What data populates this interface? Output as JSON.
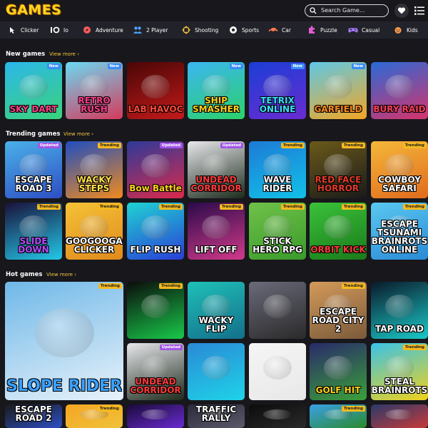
{
  "header": {
    "logo": "GAMES",
    "search_placeholder": "Search Game..."
  },
  "nav": [
    {
      "label": "Clicker",
      "icon": "cursor-click-icon",
      "color": "#ffffff"
    },
    {
      "label": "Io",
      "icon": "io-icon",
      "color": "#ffffff"
    },
    {
      "label": "Adventure",
      "icon": "compass-icon",
      "color": "#ff5a5a"
    },
    {
      "label": "2 Player",
      "icon": "two-player-icon",
      "color": "#4da3ff"
    },
    {
      "label": "Shooting",
      "icon": "crosshair-icon",
      "color": "#f5c63f"
    },
    {
      "label": "Sports",
      "icon": "soccer-ball-icon",
      "color": "#ffffff"
    },
    {
      "label": "Car",
      "icon": "car-icon",
      "color": "#ff7a4d"
    },
    {
      "label": "Puzzle",
      "icon": "puzzle-icon",
      "color": "#e55ad1"
    },
    {
      "label": "Casual",
      "icon": "gamepad-icon",
      "color": "#a57bff"
    },
    {
      "label": "Kids",
      "icon": "kids-icon",
      "color": "#ff9d4d"
    }
  ],
  "sections": {
    "new": {
      "title": "New games",
      "view_more": "View more ›"
    },
    "trending": {
      "title": "Trending games",
      "view_more": "View more ›"
    },
    "hot": {
      "title": "Hot games",
      "view_more": "View more ›"
    }
  },
  "badges": {
    "new": "New",
    "updated": "Updated",
    "trending": "Trending"
  },
  "new_games": [
    {
      "title": "SKY DART",
      "badge": "new",
      "bg": "#2bb7ea",
      "bg2": "#3ad37a",
      "fg": "#ff3f87"
    },
    {
      "title": "RETRO RUSH",
      "badge": "new",
      "bg": "#6cd9f2",
      "bg2": "#d43a5c",
      "fg": "#ff3d8b"
    },
    {
      "title": "LAB HAVOC",
      "badge": "",
      "bg": "#4a0606",
      "bg2": "#c31a1a",
      "fg": "#ff4a3a"
    },
    {
      "title": "SHIP SMASHER",
      "badge": "new",
      "bg": "#3bb6f2",
      "bg2": "#2bd16b",
      "fg": "#ffd11a"
    },
    {
      "title": "TETRIX ONLINE",
      "badge": "new",
      "bg": "#1b3ed6",
      "bg2": "#6a2bd1",
      "fg": "#3ae0ff"
    },
    {
      "title": "GARFIELD",
      "badge": "new",
      "bg": "#5ec8e6",
      "bg2": "#f3a623",
      "fg": "#ff8a1a"
    },
    {
      "title": "BURY RAID",
      "badge": "",
      "bg": "#2a6ad6",
      "bg2": "#d6336c",
      "fg": "#ff3d5a"
    }
  ],
  "trending_games": [
    {
      "title": "ESCAPE ROAD 3",
      "badge": "updated",
      "bg": "#4bb0e8",
      "bg2": "#2d4fc4",
      "fg": "#ffffff"
    },
    {
      "title": "WACKY STEPS",
      "badge": "trending",
      "bg": "#1f4ec0",
      "bg2": "#f08a1f",
      "fg": "#ffe14a"
    },
    {
      "title": "Bow Battle",
      "badge": "updated",
      "bg": "#2d3a9a",
      "bg2": "#db2a4a",
      "fg": "#ffd11a"
    },
    {
      "title": "UNDEAD CORRIDOR",
      "badge": "updated",
      "bg": "#e8e8ec",
      "bg2": "#1c2b1c",
      "fg": "#ff3a3a"
    },
    {
      "title": "WAVE RIDER",
      "badge": "trending",
      "bg": "#1d7bd6",
      "bg2": "#12c1e8",
      "fg": "#ffffff"
    },
    {
      "title": "RED FACE HORROR",
      "badge": "trending",
      "bg": "#6b5a1a",
      "bg2": "#1a1a1a",
      "fg": "#e23a2a"
    },
    {
      "title": "COWBOY SAFARI",
      "badge": "trending",
      "bg": "#f5b83a",
      "bg2": "#e06b1d",
      "fg": "#ffffff"
    },
    {
      "title": "SLIDE DOWN",
      "badge": "trending",
      "bg": "#1a103a",
      "bg2": "#23c8e8",
      "fg": "#b84dff"
    },
    {
      "title": "GOOGOOGAGA CLICKER",
      "badge": "trending",
      "bg": "#f5c236",
      "bg2": "#e08a1d",
      "fg": "#ffffff"
    },
    {
      "title": "FLIP RUSH",
      "badge": "trending",
      "bg": "#1fd3d3",
      "bg2": "#2a3ed6",
      "fg": "#ffffff"
    },
    {
      "title": "LIFT OFF",
      "badge": "trending",
      "bg": "#2a0a4a",
      "bg2": "#d13a8a",
      "fg": "#ffffff"
    },
    {
      "title": "STICK HERO RPG",
      "badge": "trending",
      "bg": "#6fc24a",
      "bg2": "#3a9a2a",
      "fg": "#ffffff"
    },
    {
      "title": "ORBIT KICK",
      "badge": "trending",
      "bg": "#3ac23a",
      "bg2": "#1a7a1a",
      "fg": "#ff3a3a"
    },
    {
      "title": "ESCAPE TSUNAMI BRAINROTS ONLINE",
      "badge": "trending",
      "bg": "#5ac8f0",
      "bg2": "#2a8ad6",
      "fg": "#ffffff"
    }
  ],
  "hot_games": [
    {
      "title": "SLOPE RIDER",
      "badge": "trending",
      "bg": "#6fb8e8",
      "bg2": "#e8f2fa",
      "fg": "#3aa0ff"
    },
    {
      "title": "",
      "badge": "trending",
      "bg": "#0c0c0c",
      "bg2": "#18c94a",
      "fg": "#ffffff"
    },
    {
      "title": "WACKY FLIP",
      "badge": "",
      "bg": "#1fc0b8",
      "bg2": "#136f8a",
      "fg": "#ffffff"
    },
    {
      "title": "",
      "badge": "",
      "bg": "#6a6a7a",
      "bg2": "#2a2a2a",
      "fg": "#ffffff"
    },
    {
      "title": "ESCAPE ROAD CITY 2",
      "badge": "trending",
      "bg": "#d49a5a",
      "bg2": "#7a5a3a",
      "fg": "#ffffff"
    },
    {
      "title": "TAP ROAD",
      "badge": "",
      "bg": "#0a1a2a",
      "bg2": "#1ac8c8",
      "fg": "#ffffff"
    },
    {
      "title": "UNDEAD CORRIDOR",
      "badge": "updated",
      "bg": "#e8e8ec",
      "bg2": "#1c2b1c",
      "fg": "#ff3a3a"
    },
    {
      "title": "",
      "badge": "",
      "bg": "#2a8ad6",
      "bg2": "#1fd3e8",
      "fg": "#ffffff"
    },
    {
      "title": "",
      "badge": "",
      "bg": "#f5f5f5",
      "bg2": "#e8e8e8",
      "fg": "#000000"
    },
    {
      "title": "GOLF HIT",
      "badge": "",
      "bg": "#2a2a6a",
      "bg2": "#3aa03a",
      "fg": "#ffd11a"
    },
    {
      "title": "STEAL BRAINROTS",
      "badge": "trending",
      "bg": "#3ac2e8",
      "bg2": "#f0d21a",
      "fg": "#ffffff"
    },
    {
      "title": "ESCAPE ROAD 2",
      "badge": "",
      "bg": "#1a1a1a",
      "bg2": "#2d4fc4",
      "fg": "#ffffff"
    },
    {
      "title": "",
      "badge": "trending",
      "bg": "#f5a623",
      "bg2": "#f0c23a",
      "fg": "#ffffff"
    },
    {
      "title": "",
      "badge": "",
      "bg": "#1a0a3a",
      "bg2": "#6a2bd1",
      "fg": "#ffffff"
    },
    {
      "title": "TRAFFIC RALLY",
      "badge": "",
      "bg": "#2a2a3a",
      "bg2": "#5a5a6a",
      "fg": "#ffffff"
    },
    {
      "title": "",
      "badge": "",
      "bg": "#0c0c0c",
      "bg2": "#2a2a2a",
      "fg": "#ffffff"
    },
    {
      "title": "",
      "badge": "trending",
      "bg": "#3aa0e8",
      "bg2": "#2a8a2a",
      "fg": "#ffffff"
    },
    {
      "title": "",
      "badge": "",
      "bg": "#2a3a6a",
      "bg2": "#c83a3a",
      "fg": "#ffffff"
    }
  ]
}
